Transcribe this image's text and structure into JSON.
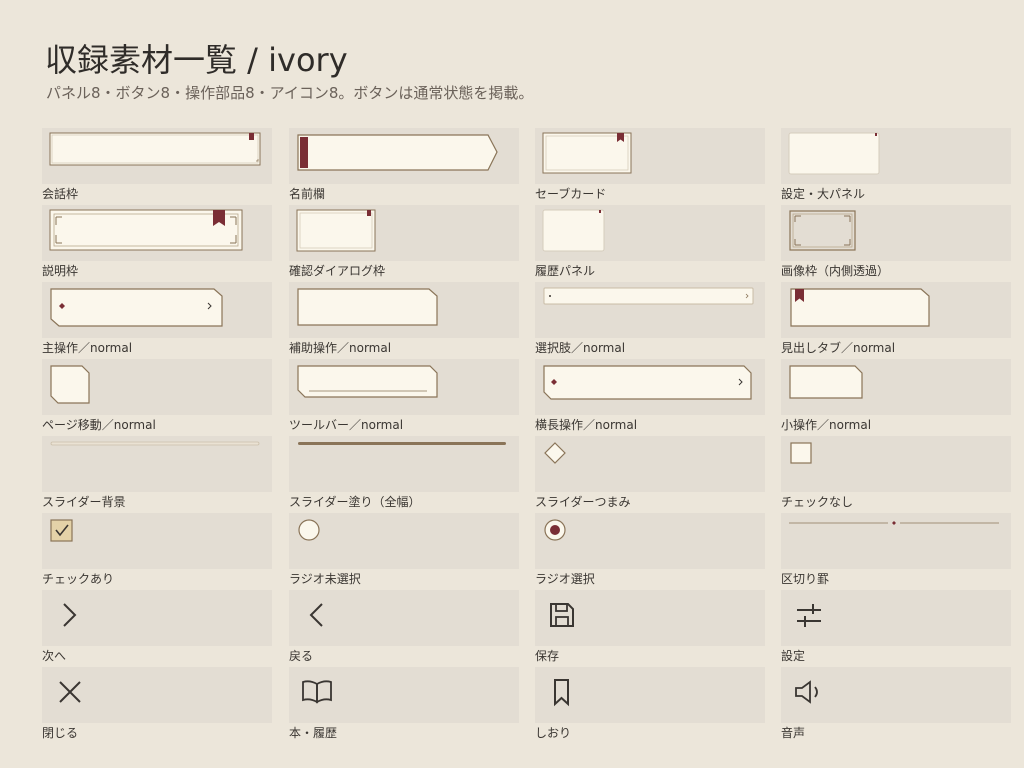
{
  "page": {
    "title": "収録素材一覧 / ivory",
    "subtitle": "パネル8・ボタン8・操作部品8・アイコン8。ボタンは通常状態を掲載。"
  },
  "colors": {
    "background": "#ece6da",
    "preview_bg": "#e3ddd3",
    "panel_fill": "#fbf7ec",
    "border_gold": "#8a7458",
    "accent_maroon": "#7a2e35",
    "icon_dark": "#3a3632"
  },
  "items": [
    {
      "label": "会話枠",
      "icon": "dialog-frame"
    },
    {
      "label": "名前欄",
      "icon": "name-plate"
    },
    {
      "label": "セーブカード",
      "icon": "save-card"
    },
    {
      "label": "設定・大パネル",
      "icon": "settings-panel"
    },
    {
      "label": "説明枠",
      "icon": "description-frame"
    },
    {
      "label": "確認ダイアログ枠",
      "icon": "confirm-dialog-frame"
    },
    {
      "label": "履歴パネル",
      "icon": "history-panel"
    },
    {
      "label": "画像枠（内側透過）",
      "icon": "image-frame"
    },
    {
      "label": "主操作／normal",
      "icon": "primary-button"
    },
    {
      "label": "補助操作／normal",
      "icon": "secondary-button"
    },
    {
      "label": "選択肢／normal",
      "icon": "choice-button"
    },
    {
      "label": "見出しタブ／normal",
      "icon": "heading-tab"
    },
    {
      "label": "ページ移動／normal",
      "icon": "page-button"
    },
    {
      "label": "ツールバー／normal",
      "icon": "toolbar-button"
    },
    {
      "label": "横長操作／normal",
      "icon": "wide-button"
    },
    {
      "label": "小操作／normal",
      "icon": "small-button"
    },
    {
      "label": "スライダー背景",
      "icon": "slider-track"
    },
    {
      "label": "スライダー塗り（全幅）",
      "icon": "slider-fill"
    },
    {
      "label": "スライダーつまみ",
      "icon": "slider-thumb"
    },
    {
      "label": "チェックなし",
      "icon": "checkbox-unchecked"
    },
    {
      "label": "チェックあり",
      "icon": "checkbox-checked"
    },
    {
      "label": "ラジオ未選択",
      "icon": "radio-unselected"
    },
    {
      "label": "ラジオ選択",
      "icon": "radio-selected"
    },
    {
      "label": "区切り罫",
      "icon": "divider"
    },
    {
      "label": "次へ",
      "icon": "chevron-right-icon"
    },
    {
      "label": "戻る",
      "icon": "chevron-left-icon"
    },
    {
      "label": "保存",
      "icon": "save-icon"
    },
    {
      "label": "設定",
      "icon": "settings-sliders-icon"
    },
    {
      "label": "閉じる",
      "icon": "close-icon"
    },
    {
      "label": "本・履歴",
      "icon": "book-icon"
    },
    {
      "label": "しおり",
      "icon": "bookmark-icon"
    },
    {
      "label": "音声",
      "icon": "speaker-icon"
    }
  ]
}
